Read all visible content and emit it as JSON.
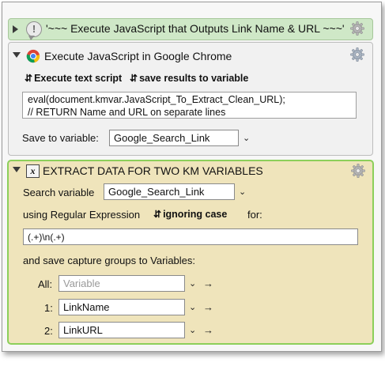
{
  "actions": {
    "comment": {
      "title": "'~~~ Execute JavaScript that Outputs Link Name & URL ~~~'"
    },
    "chrome_js": {
      "title": "Execute JavaScript in Google Chrome",
      "execute_option": "Execute text script",
      "save_option": "save results to variable",
      "script_lines": [
        "eval(document.kmvar.JavaScript_To_Extract_Clean_URL);",
        "// RETURN Name and URL on separate lines"
      ],
      "save_label": "Save to variable:",
      "save_variable": "Google_Search_Link"
    },
    "regex": {
      "title": "EXTRACT DATA FOR TWO KM VARIABLES",
      "search_label": "Search variable",
      "search_variable": "Google_Search_Link",
      "using_label": "using Regular Expression",
      "case_option": "ignoring case",
      "for_label": "for:",
      "pattern": "(.+)\\n(.+)",
      "save_groups_label": "and save capture groups to Variables:",
      "groups": [
        {
          "label": "All:",
          "value": "",
          "placeholder": "Variable"
        },
        {
          "label": "1:",
          "value": "LinkName",
          "placeholder": ""
        },
        {
          "label": "2:",
          "value": "LinkURL",
          "placeholder": ""
        }
      ]
    }
  },
  "icons": {
    "comment": "comment-bubble-icon",
    "chrome": "chrome-icon",
    "regex": "regex-x-icon",
    "gear": "gear-icon",
    "popup": "chevron-down-icon",
    "updown": "updown-chevron-icon",
    "arrow": "right-arrow-icon"
  },
  "colors": {
    "comment_bg": "#cfe8c7",
    "regex_bg": "#efe4bb",
    "selected_border": "#8ccf5a"
  }
}
